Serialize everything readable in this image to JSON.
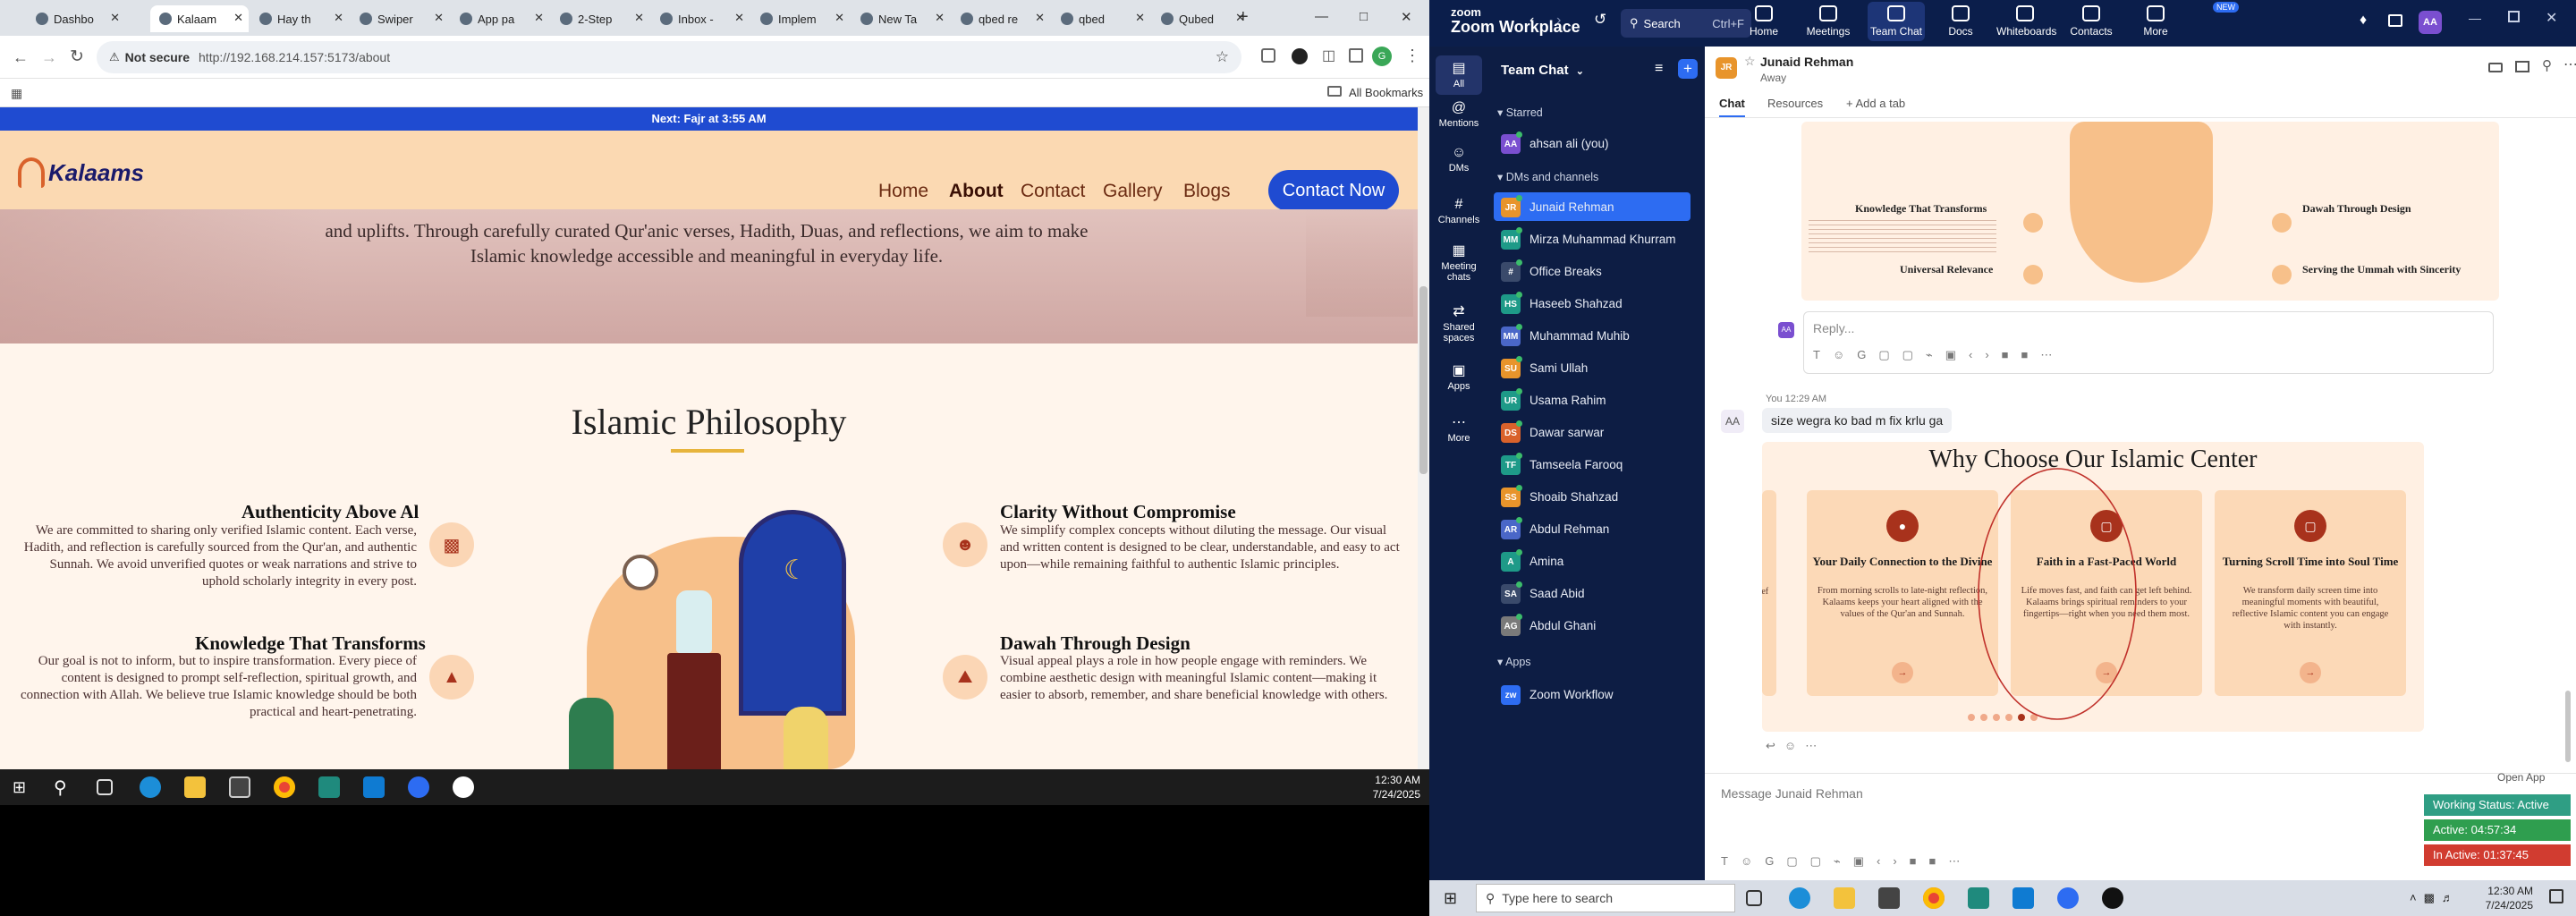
{
  "browser": {
    "tabs": [
      {
        "label": "Dashbo"
      },
      {
        "label": "Kalaam",
        "active": true
      },
      {
        "label": "Hay th"
      },
      {
        "label": "Swiper"
      },
      {
        "label": "App pa"
      },
      {
        "label": "2-Step"
      },
      {
        "label": "Inbox -"
      },
      {
        "label": "Implem"
      },
      {
        "label": "New Ta"
      },
      {
        "label": "qbed re"
      },
      {
        "label": "qbed"
      },
      {
        "label": "Qubed"
      }
    ],
    "security_label": "Not secure",
    "url": "http://192.168.214.157:5173/about",
    "bookmarks_label": "All Bookmarks"
  },
  "site": {
    "announcement": "Next: Fajr at 3:55 AM",
    "logo_text": "Kalaams",
    "nav": [
      "Home",
      "About",
      "Contact",
      "Gallery",
      "Blogs"
    ],
    "nav_active": "About",
    "cta": "Contact Now",
    "hero_text": "and uplifts. Through carefully curated Qur'anic verses, Hadith, Duas, and reflections, we aim to make Islamic knowledge accessible and meaningful in everyday life.",
    "section_title": "Islamic Philosophy",
    "left_items": [
      {
        "title": "Authenticity Above Al",
        "text": "We are committed to sharing only verified Islamic content. Each verse, Hadith, and reflection is carefully sourced from the Qur'an, and authentic Sunnah. We avoid unverified quotes or weak narrations and strive to uphold scholarly integrity in every post."
      },
      {
        "title": "Knowledge That Transforms",
        "text": "Our goal is not to inform, but to inspire transformation. Every piece of content is designed to prompt self-reflection, spiritual growth, and connection with Allah. We believe true Islamic knowledge should be both practical and heart-penetrating."
      }
    ],
    "right_items": [
      {
        "title": "Clarity Without Compromise",
        "text": "We simplify complex concepts without diluting the message. Our visual and written content is designed to be clear, understandable, and easy to act upon—while remaining faithful to authentic Islamic principles."
      },
      {
        "title": "Dawah Through Design",
        "text": "Visual appeal plays a role in how people engage with reminders. We combine aesthetic design with meaningful Islamic content—making it easier to absorb, remember, and share beneficial knowledge with others."
      }
    ]
  },
  "taskbar_left": {
    "time": "12:30 AM",
    "date": "7/24/2025"
  },
  "zoom": {
    "app_name": "Zoom Workplace",
    "search_placeholder": "Search",
    "search_shortcut": "Ctrl+F",
    "top_tabs": [
      "Home",
      "Meetings",
      "Team Chat",
      "Docs",
      "Whiteboards",
      "Contacts",
      "More"
    ],
    "top_tab_active": "Team Chat",
    "new_badge": "NEW",
    "user_initials": "AA",
    "side_nav": [
      "All",
      "Mentions",
      "DMs",
      "Channels",
      "Meeting chats",
      "Shared spaces",
      "Apps",
      "More"
    ],
    "panel_title": "Team Chat",
    "sections": {
      "starred": "Starred",
      "dms": "DMs and channels",
      "apps": "Apps"
    },
    "starred": [
      {
        "name": "ahsan ali (you)",
        "initials": "AA",
        "color": "#7a4fd0"
      }
    ],
    "dms": [
      {
        "name": "Junaid Rehman",
        "initials": "JR",
        "color": "#e8942b",
        "selected": true
      },
      {
        "name": "Mirza Muhammad Khurram",
        "initials": "MM",
        "color": "#1e9a88"
      },
      {
        "name": "Office Breaks",
        "initials": "#",
        "color": "#3a4a6b"
      },
      {
        "name": "Haseeb Shahzad",
        "initials": "HS",
        "color": "#1e9a88"
      },
      {
        "name": "Muhammad Muhib",
        "initials": "MM",
        "color": "#4a67c8"
      },
      {
        "name": "Sami Ullah",
        "initials": "SU",
        "color": "#e8942b"
      },
      {
        "name": "Usama Rahim",
        "initials": "UR",
        "color": "#1e9a88"
      },
      {
        "name": "Dawar sarwar",
        "initials": "DS",
        "color": "#d9622b"
      },
      {
        "name": "Tamseela Farooq",
        "initials": "TF",
        "color": "#1e9a88"
      },
      {
        "name": "Shoaib Shahzad",
        "initials": "SS",
        "color": "#e8942b"
      },
      {
        "name": "Abdul Rehman",
        "initials": "AR",
        "color": "#4a67c8"
      },
      {
        "name": "Amina",
        "initials": "A",
        "color": "#1e9a88"
      },
      {
        "name": "Saad Abid",
        "initials": "SA",
        "color": "#3a4a6b"
      },
      {
        "name": "Abdul Ghani",
        "initials": "AG",
        "color": "#7a7a7a"
      }
    ],
    "apps": [
      {
        "name": "Zoom Workflow"
      }
    ],
    "chat_header": {
      "name": "Junaid Rehman",
      "initials": "JR",
      "status": "Away"
    },
    "chat_tabs": [
      "Chat",
      "Resources",
      "Add a tab"
    ],
    "reply_placeholder": "Reply...",
    "message": {
      "meta": "You 12:29 AM",
      "text": "size wegra ko bad m fix krlu ga",
      "sender_initials": "AA"
    },
    "shared_image": {
      "title": "Why Choose Our Islamic Center",
      "cards": [
        {
          "title": "Your Daily Connection to the Divine",
          "text": "From morning scrolls to late-night reflection, Kalaams keeps your heart aligned with the values of the Qur'an and Sunnah."
        },
        {
          "title": "Faith in a Fast-Paced World",
          "text": "Life moves fast, and faith can get left behind. Kalaams brings spiritual reminders to your fingertips—right when you need them most."
        },
        {
          "title": "Turning Scroll Time into Soul Time",
          "text": "We transform daily screen time into meaningful moments with beautiful, reflective Islamic content you can engage with instantly."
        }
      ],
      "edge_text": "ref"
    },
    "prev_image_items": [
      {
        "title": "Knowledge That Transforms"
      },
      {
        "title": "Universal Relevance"
      },
      {
        "title": "Dawah Through Design"
      },
      {
        "title": "Serving the Ummah with Sincerity"
      }
    ],
    "compose_placeholder": "Message Junaid Rehman",
    "open_app": "Open App",
    "status_panel": {
      "working": "Working Status: Active",
      "active": "Active: 04:57:34",
      "inactive": "In Active: 01:37:45"
    },
    "taskbar_search": "Type here to search",
    "taskbar_time": "12:30 AM",
    "taskbar_date": "7/24/2025"
  }
}
